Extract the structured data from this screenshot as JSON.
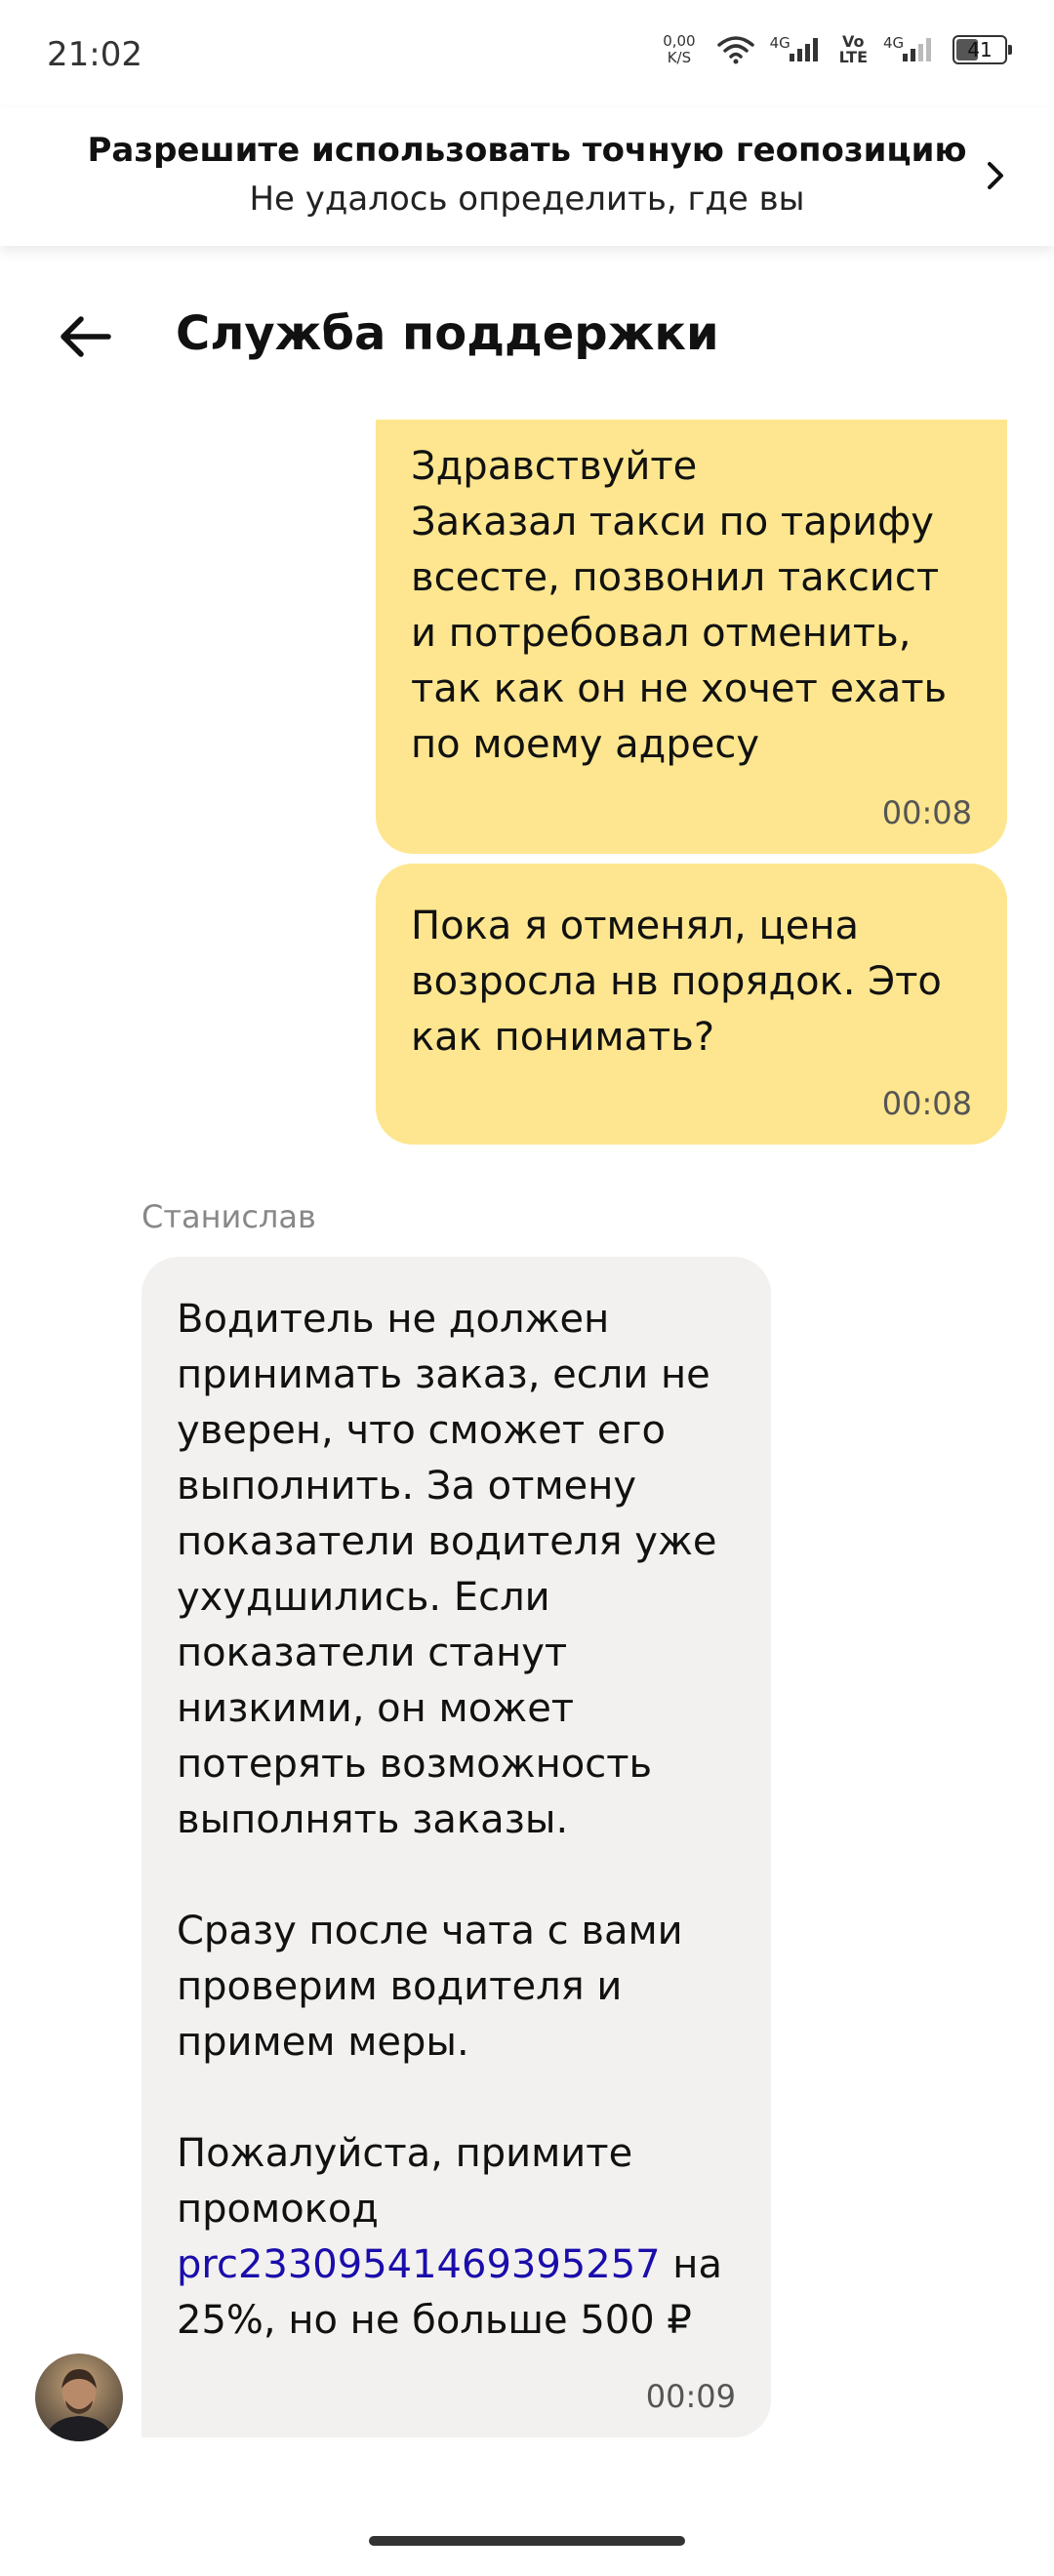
{
  "status_bar": {
    "time": "21:02",
    "net_speed_value": "0,00",
    "net_speed_unit": "K/S",
    "signal1_label": "4G",
    "volte_top": "Vo",
    "volte_bottom": "LTE",
    "signal2_label": "4G",
    "battery": "41"
  },
  "geo_banner": {
    "title": "Разрешите использовать точную геопозицию",
    "subtitle": "Не удалось определить, где вы"
  },
  "header": {
    "title": "Служба поддержки"
  },
  "messages": [
    {
      "text": "Здравствуйте\nЗаказал такси по тарифу всесте, позвонил таксист и потребовал отменить, так как он не хочет ехать по моему адресу",
      "time": "00:08"
    },
    {
      "text": "Пока я отменял, цена возросла нв порядок. Это как понимать?",
      "time": "00:08"
    },
    {
      "sender": "Станислав",
      "text_part1": "Водитель не должен принимать заказ, если не уверен, что сможет его выполнить. За отмену показатели водителя уже ухудшились. Если показатели станут низкими, он может потерять возможность выполнять заказы.\n\nСразу после чата с вами проверим водителя и примем меры.\n\nПожалуйста, примите промокод ",
      "promo_code": "prc23309541469395257",
      "text_part2": " на 25%, но не больше 500 ₽",
      "time": "00:09"
    }
  ],
  "colors": {
    "outgoing_bubble": "#fde68f",
    "incoming_bubble": "#f2f1ef",
    "link": "#1a0dab"
  }
}
